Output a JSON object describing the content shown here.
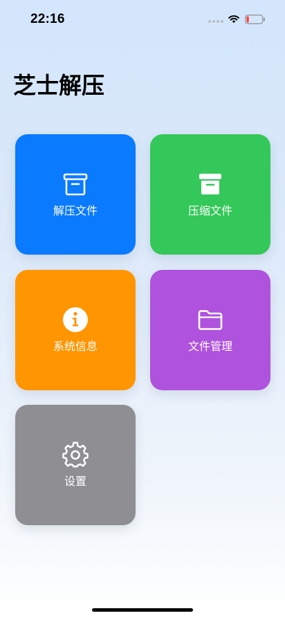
{
  "status_bar": {
    "time": "22:16",
    "signal_icon": "signal-dots-icon",
    "wifi_icon": "wifi-icon",
    "battery_icon": "battery-low-icon",
    "battery_level": 0.15,
    "battery_color": "#ff3b30"
  },
  "app": {
    "title": "芝士解压"
  },
  "tiles": [
    {
      "label": "解压文件",
      "icon": "archive-box-open-icon",
      "color": "#0a7aff"
    },
    {
      "label": "压缩文件",
      "icon": "archive-box-filled-icon",
      "color": "#34c759"
    },
    {
      "label": "系统信息",
      "icon": "info-circle-icon",
      "color": "#ff9500"
    },
    {
      "label": "文件管理",
      "icon": "folder-icon",
      "color": "#af52de"
    },
    {
      "label": "设置",
      "icon": "gear-icon",
      "color": "#8e8e93"
    }
  ]
}
